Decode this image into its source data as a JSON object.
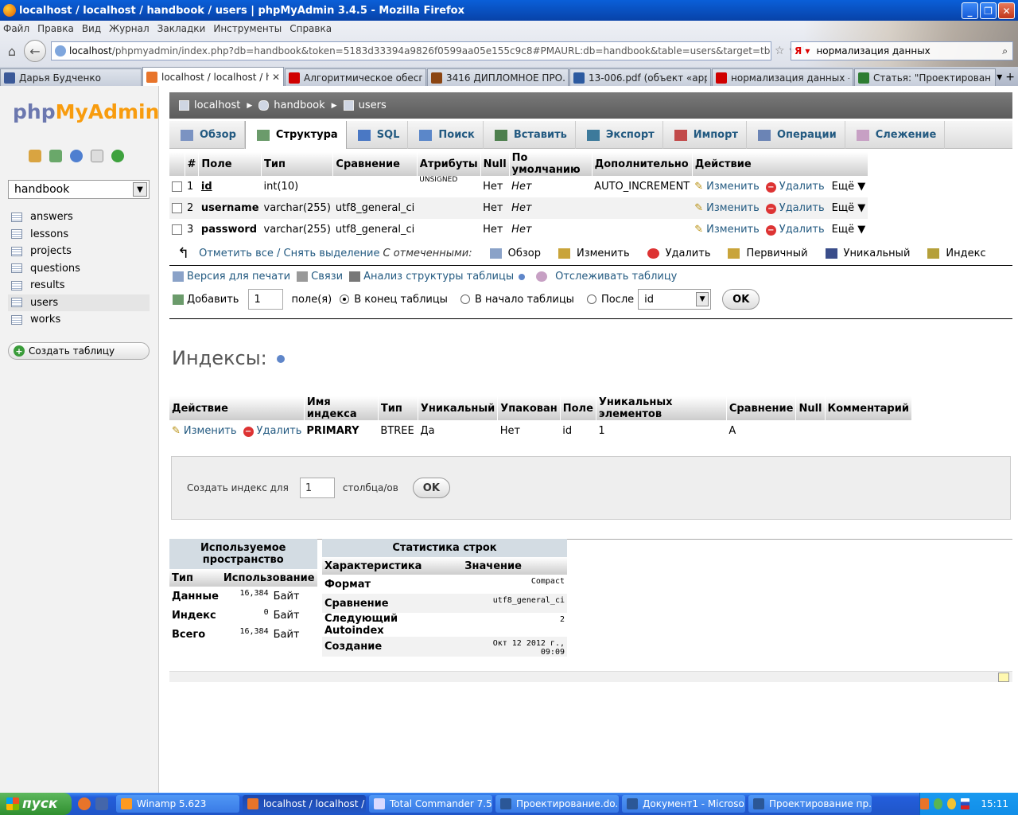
{
  "window": {
    "title": "localhost / localhost / handbook / users | phpMyAdmin 3.4.5 - Mozilla Firefox"
  },
  "menu": [
    "Файл",
    "Правка",
    "Вид",
    "Журнал",
    "Закладки",
    "Инструменты",
    "Справка"
  ],
  "url": {
    "host": "localhost",
    "rest": "/phpmyadmin/index.php?db=handbook&token=5183d33394a9826f0599aa05e155c9c8#PMAURL:db=handbook&table=users&target=tbl_structure.php&token=5183d3"
  },
  "search": {
    "value": "нормализация данных"
  },
  "browser_tabs": [
    {
      "label": "Дарья Будченко",
      "color": "#3b5998"
    },
    {
      "label": "localhost / localhost / han...",
      "color": "#e8742a"
    },
    {
      "label": "Алгоритмическое обеспе...",
      "color": "#d00000"
    },
    {
      "label": "3416 ДИПЛОМНОЕ ПРО...",
      "color": "#8b4513"
    },
    {
      "label": "13-006.pdf (объект «appli...",
      "color": "#2c5aa0"
    },
    {
      "label": "нормализация данных – ...",
      "color": "#d00000"
    },
    {
      "label": "Статья: \"Проектировани...",
      "color": "#2e7d32"
    }
  ],
  "sidebar": {
    "logo_php": "php",
    "logo_ma": "MyAdmin",
    "db_selected": "handbook",
    "tables": [
      "answers",
      "lessons",
      "projects",
      "questions",
      "results",
      "users",
      "works"
    ],
    "selected_table": "users",
    "create_table": "Создать таблицу"
  },
  "breadcrumb": {
    "server": "localhost",
    "db": "handbook",
    "table": "users"
  },
  "tabs": [
    {
      "label": "Обзор",
      "color": "#7b93c2"
    },
    {
      "label": "Структура",
      "color": "#6b9b6b"
    },
    {
      "label": "SQL",
      "color": "#4a78c4"
    },
    {
      "label": "Поиск",
      "color": "#5b87c9"
    },
    {
      "label": "Вставить",
      "color": "#4d7f4d"
    },
    {
      "label": "Экспорт",
      "color": "#3d7a9b"
    },
    {
      "label": "Импорт",
      "color": "#c24a4a"
    },
    {
      "label": "Операции",
      "color": "#6b84b5"
    },
    {
      "label": "Слежение",
      "color": "#c7a0c4"
    }
  ],
  "structure": {
    "headers": [
      "#",
      "Поле",
      "Тип",
      "Сравнение",
      "Атрибуты",
      "Null",
      "По умолчанию",
      "Дополнительно",
      "Действие"
    ],
    "rows": [
      {
        "num": "1",
        "field": "id",
        "type": "int(10)",
        "collation": "",
        "attributes": "UNSIGNED",
        "null": "Нет",
        "default": "Нет",
        "extra": "AUTO_INCREMENT"
      },
      {
        "num": "2",
        "field": "username",
        "type": "varchar(255)",
        "collation": "utf8_general_ci",
        "attributes": "",
        "null": "Нет",
        "default": "Нет",
        "extra": ""
      },
      {
        "num": "3",
        "field": "password",
        "type": "varchar(255)",
        "collation": "utf8_general_ci",
        "attributes": "",
        "null": "Нет",
        "default": "Нет",
        "extra": ""
      }
    ],
    "action_edit": "Изменить",
    "action_delete": "Удалить",
    "action_more": "Ещё"
  },
  "bulk": {
    "check_all": "Отметить все / Снять выделение",
    "with_selected": "С отмеченными:",
    "ops": [
      "Обзор",
      "Изменить",
      "Удалить",
      "Первичный",
      "Уникальный",
      "Индекс"
    ]
  },
  "links": {
    "print": "Версия для печати",
    "relations": "Связи",
    "analyze": "Анализ структуры таблицы",
    "track": "Отслеживать таблицу"
  },
  "addfield": {
    "label": "Добавить",
    "count": "1",
    "fields": "поле(я)",
    "end": "В конец таблицы",
    "start": "В начало таблицы",
    "after": "После",
    "after_col": "id",
    "ok": "OK"
  },
  "indexes": {
    "title": "Индексы:",
    "headers": [
      "Действие",
      "Имя индекса",
      "Тип",
      "Уникальный",
      "Упакован",
      "Поле",
      "Уникальных элементов",
      "Сравнение",
      "Null",
      "Комментарий"
    ],
    "row": {
      "name": "PRIMARY",
      "type": "BTREE",
      "unique": "Да",
      "packed": "Нет",
      "field": "id",
      "cardinality": "1",
      "collation": "A",
      "null": "",
      "comment": ""
    },
    "edit": "Изменить",
    "delete": "Удалить"
  },
  "createindex": {
    "label": "Создать индекс для",
    "count": "1",
    "cols": "столбца/ов",
    "ok": "OK"
  },
  "space": {
    "caption": "Используемое пространство",
    "headers": [
      "Тип",
      "Использование"
    ],
    "rows": [
      {
        "type": "Данные",
        "value": "16,384",
        "unit": "Байт"
      },
      {
        "type": "Индекс",
        "value": "0",
        "unit": "Байт"
      },
      {
        "type": "Всего",
        "value": "16,384",
        "unit": "Байт"
      }
    ]
  },
  "stats": {
    "caption": "Статистика строк",
    "headers": [
      "Характеристика",
      "Значение"
    ],
    "rows": [
      {
        "name": "Формат",
        "value": "Compact"
      },
      {
        "name": "Сравнение",
        "value": "utf8_general_ci"
      },
      {
        "name": "Следующий Autoindex",
        "value": "2"
      },
      {
        "name": "Создание",
        "value": "Окт 12 2012 г., 09:09"
      }
    ]
  },
  "taskbar": {
    "start": "пуск",
    "tasks": [
      {
        "label": "Winamp 5.623",
        "color": "#ff9a1f"
      },
      {
        "label": "localhost / localhost / ...",
        "color": "#e8742a"
      },
      {
        "label": "Total Commander 7.5...",
        "color": "#d9d9ff"
      },
      {
        "label": "Проектирование.do...",
        "color": "#2b5797"
      },
      {
        "label": "Документ1 - Microso...",
        "color": "#2b5797"
      },
      {
        "label": "Проектирование пр...",
        "color": "#2b5797"
      }
    ],
    "clock": "15:11"
  }
}
